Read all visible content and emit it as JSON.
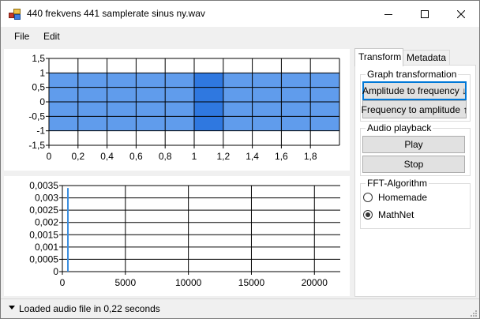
{
  "window": {
    "title": "440 frekvens 441 samplerate sinus ny.wav"
  },
  "menu": [
    {
      "label": "File"
    },
    {
      "label": "Edit"
    }
  ],
  "tabs": [
    {
      "label": "Transform",
      "active": true
    },
    {
      "label": "Metadata",
      "active": false
    }
  ],
  "groups": {
    "graph": {
      "title": "Graph transformation",
      "amp_to_freq": "Amplitude to frequency ↓",
      "freq_to_amp": "Frequency to amplitude ↑"
    },
    "audio": {
      "title": "Audio playback",
      "play": "Play",
      "stop": "Stop"
    },
    "fft": {
      "title": "FFT-Algorithm",
      "options": [
        {
          "label": "Homemade",
          "checked": false
        },
        {
          "label": "MathNet",
          "checked": true
        }
      ]
    }
  },
  "status": {
    "text": "Loaded audio file in 0,22 seconds"
  },
  "colors": {
    "signal": "#3d86e8",
    "signal_dark": "#2f78e0",
    "spectrum": "#3a8de0"
  },
  "chart_data": [
    {
      "type": "area",
      "ylim": [
        -1.5,
        1.5
      ],
      "xlim": [
        0,
        2
      ],
      "yticks": [
        "1,5",
        "1",
        "0,5",
        "0",
        "-0,5",
        "-1",
        "-1,5"
      ],
      "xticks": [
        "0",
        "0,2",
        "0,4",
        "0,6",
        "0,8",
        "1",
        "1,2",
        "1,4",
        "1,6",
        "1,8"
      ],
      "grid": true,
      "series": [
        {
          "x": [
            0,
            2
          ],
          "y_min": -1,
          "y_max": 1
        }
      ],
      "highlight": {
        "x_from": 1.0,
        "x_to": 1.2
      }
    },
    {
      "type": "line",
      "ylim": [
        0,
        0.0035
      ],
      "xlim": [
        0,
        22050
      ],
      "yticks": [
        "0,0035",
        "0,003",
        "0,0025",
        "0,002",
        "0,0015",
        "0,001",
        "0,0005",
        "0"
      ],
      "xticks": [
        "0",
        "5000",
        "10000",
        "15000",
        "20000"
      ],
      "grid": true,
      "series": [
        {
          "x": [
            440
          ],
          "y": [
            0.0034
          ]
        }
      ]
    }
  ]
}
